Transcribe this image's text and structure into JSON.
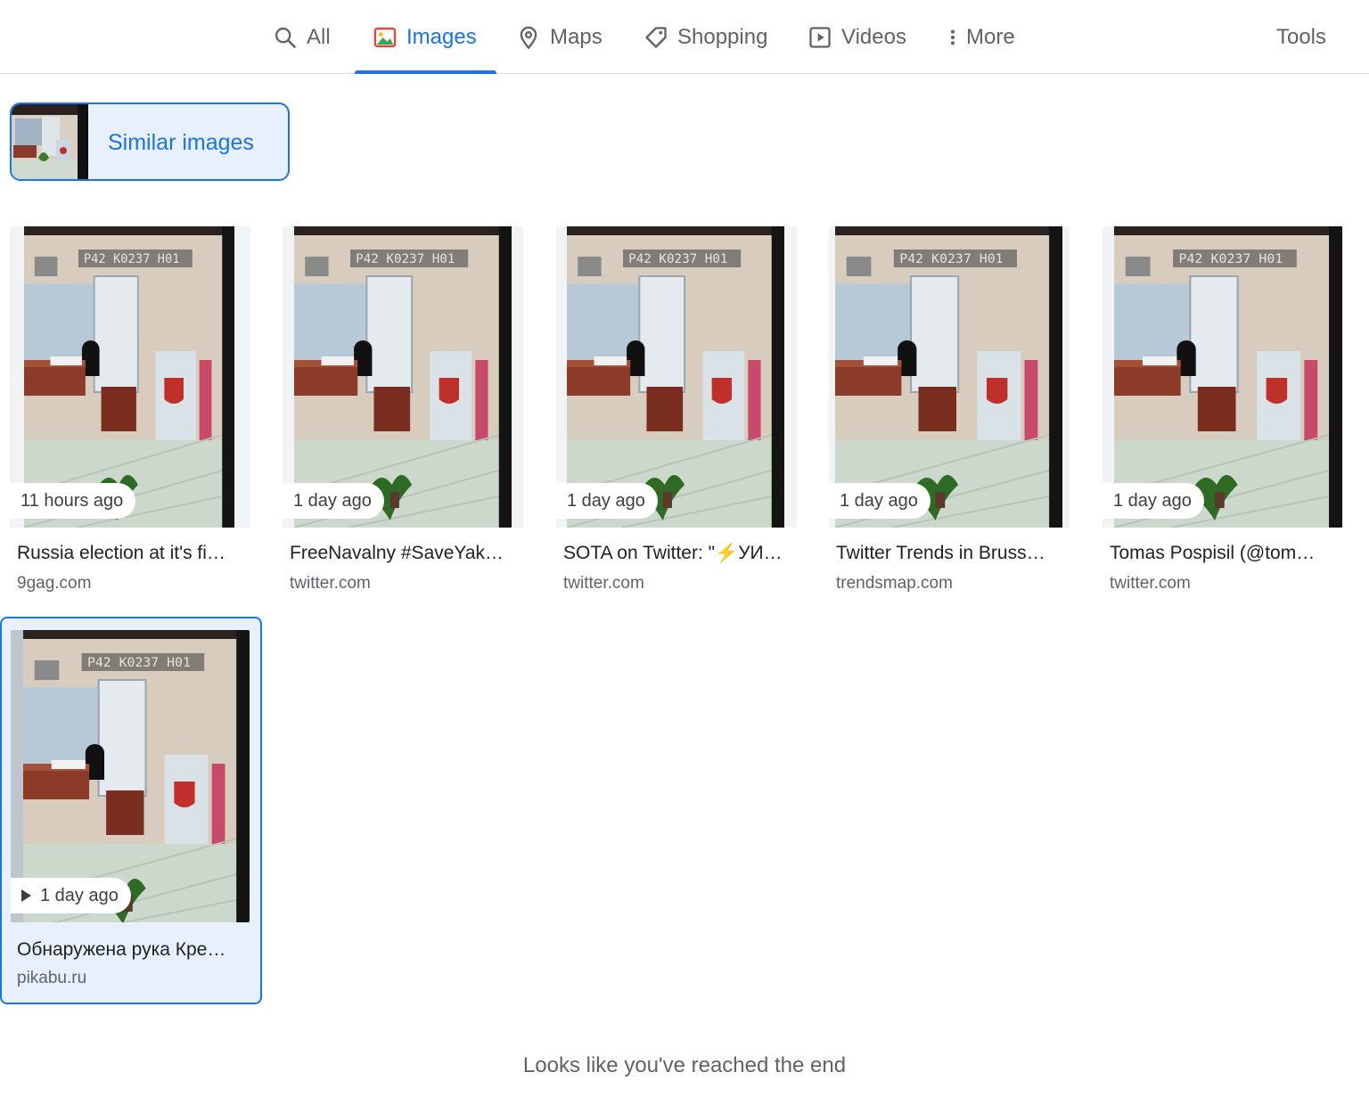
{
  "tabs": [
    {
      "label": "All",
      "icon": "search-icon"
    },
    {
      "label": "Images",
      "icon": "image-icon",
      "active": true
    },
    {
      "label": "Maps",
      "icon": "map-pin-icon"
    },
    {
      "label": "Shopping",
      "icon": "tag-icon"
    },
    {
      "label": "Videos",
      "icon": "play-square-icon"
    },
    {
      "label": "More",
      "icon": "more-vert-icon"
    }
  ],
  "tools_label": "Tools",
  "similar": {
    "label": "Similar images"
  },
  "results": [
    {
      "time": "11 hours ago",
      "title": "Russia election at it's fi…",
      "source": "9gag.com"
    },
    {
      "time": "1 day ago",
      "title": "FreeNavalny #SaveYak…",
      "source": "twitter.com"
    },
    {
      "time": "1 day ago",
      "title": "SOTA on Twitter: \"⚡УИ…",
      "source": "twitter.com"
    },
    {
      "time": "1 day ago",
      "title": "Twitter Trends in Bruss…",
      "source": "trendsmap.com"
    },
    {
      "time": "1 day ago",
      "title": "Tomas Pospisil (@tom…",
      "source": "twitter.com"
    },
    {
      "time": "1 day ago",
      "title": "Обнаружена рука Кре…",
      "source": "pikabu.ru",
      "video": true,
      "selected": true
    }
  ],
  "thumb_overlay_text": "P42 K0237 H01",
  "end_message": "Looks like you've reached the end",
  "colors": {
    "accent": "#1a73e8",
    "selected_bg": "#e8f0fe",
    "muted": "#5f6368"
  }
}
